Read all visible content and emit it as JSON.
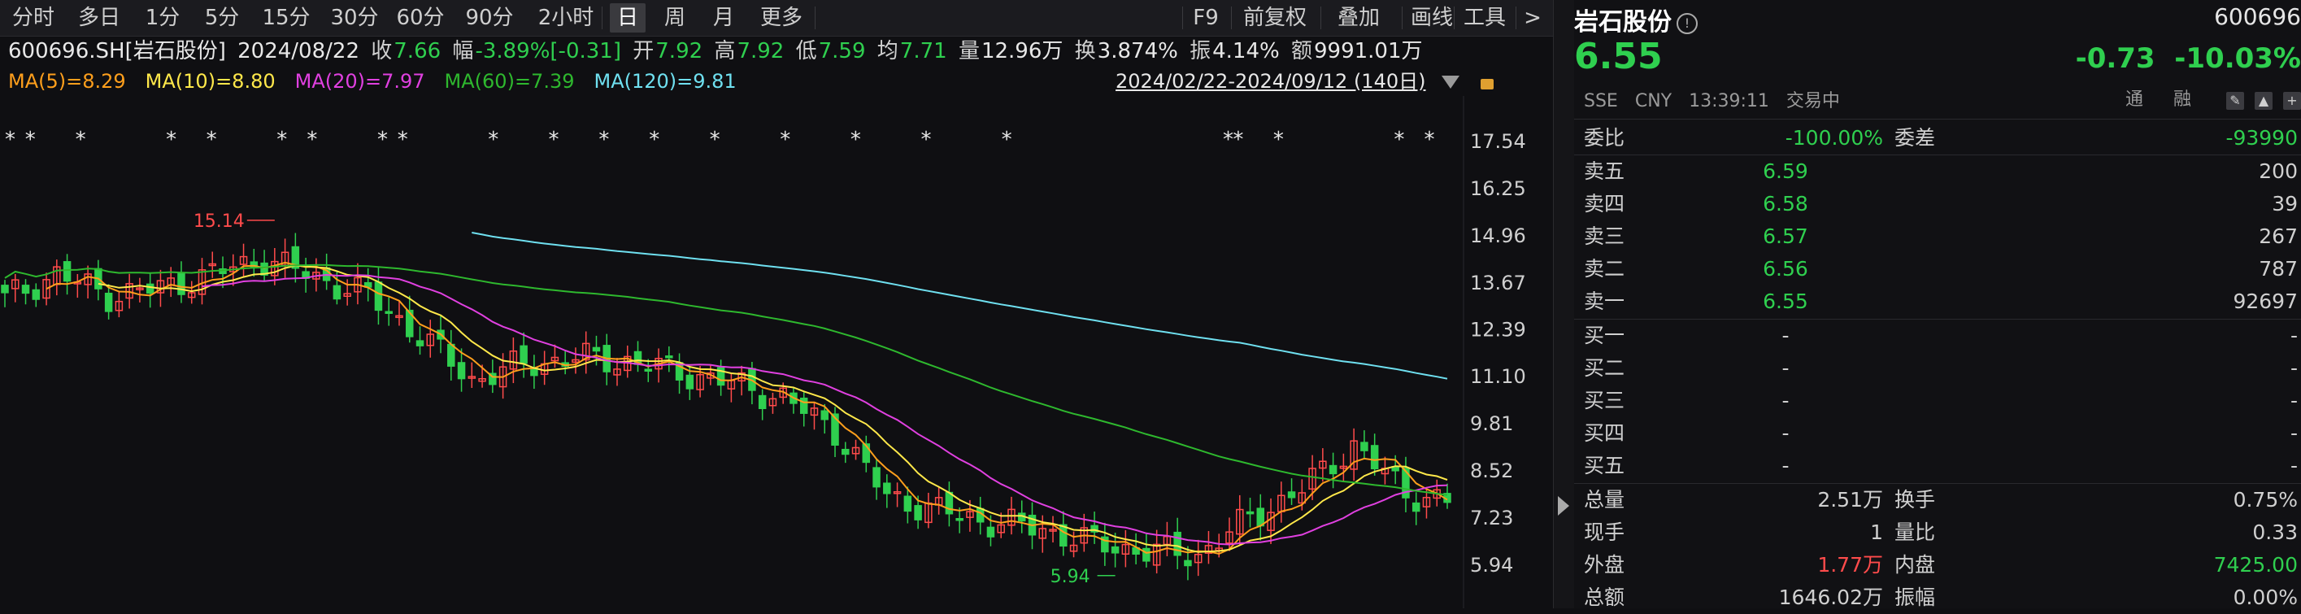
{
  "toolbar": {
    "periods": [
      "分时",
      "多日",
      "1分",
      "5分",
      "15分",
      "30分",
      "60分",
      "90分",
      "2小时",
      "日",
      "周",
      "月",
      "更多"
    ],
    "active_period": "日",
    "right_tools": [
      "F9",
      "前复权",
      "叠加",
      "画线",
      "工具",
      ">"
    ]
  },
  "quote": {
    "symbol": "600696.SH[岩石股份]",
    "date": "2024/08/22",
    "close_label": "收",
    "close": "7.66",
    "amp_label": "幅",
    "change_pct": "-3.89%[-0.31]",
    "open_label": "开",
    "open": "7.92",
    "high_label": "高",
    "high": "7.92",
    "low_label": "低",
    "low": "7.59",
    "avg_label": "均",
    "avg": "7.71",
    "vol_label": "量",
    "volume": "12.96万",
    "turn_label": "换",
    "turnover": "3.874%",
    "swing_label": "振",
    "swing": "4.14%",
    "amount_label": "额",
    "amount": "9991.01万"
  },
  "ma": [
    {
      "label": "MA(5)=8.29",
      "color": "#ff9f1c"
    },
    {
      "label": "MA(10)=8.80",
      "color": "#ffe84a"
    },
    {
      "label": "MA(20)=7.97",
      "color": "#e040e0"
    },
    {
      "label": "MA(60)=7.39",
      "color": "#2eb82e"
    },
    {
      "label": "MA(120)=9.81",
      "color": "#6fe0f0"
    }
  ],
  "range": {
    "label": "2024/02/22-2024/09/12 (140日)"
  },
  "chart_data": {
    "type": "candlestick",
    "y_ticks": [
      17.54,
      16.25,
      14.96,
      13.67,
      12.39,
      11.1,
      9.81,
      8.52,
      7.23,
      5.94
    ],
    "ylim": [
      5.4,
      18.1
    ],
    "annotations": [
      {
        "label": "15.14",
        "value": 15.14,
        "index": 26
      },
      {
        "label": "5.94",
        "value": 5.94,
        "index": 107
      }
    ],
    "ma120_start_index": 45,
    "candles_count": 140
  },
  "stock": {
    "name": "岩石股份",
    "code": "600696",
    "price": "6.55",
    "change": "-0.73",
    "change_pct": "-10.03%",
    "exchange": "SSE",
    "currency": "CNY",
    "time": "13:39:11",
    "status": "交易中",
    "tag1": "通",
    "tag2": "融"
  },
  "order_ratio": {
    "label1": "委比",
    "value1": "-100.00%",
    "label2": "委差",
    "value2": "-93990"
  },
  "asks": [
    {
      "label": "卖五",
      "price": "6.59",
      "vol": "200"
    },
    {
      "label": "卖四",
      "price": "6.58",
      "vol": "39"
    },
    {
      "label": "卖三",
      "price": "6.57",
      "vol": "267"
    },
    {
      "label": "卖二",
      "price": "6.56",
      "vol": "787"
    },
    {
      "label": "卖一",
      "price": "6.55",
      "vol": "92697"
    }
  ],
  "bids": [
    {
      "label": "买一",
      "price": "-",
      "vol": "-"
    },
    {
      "label": "买二",
      "price": "-",
      "vol": "-"
    },
    {
      "label": "买三",
      "price": "-",
      "vol": "-"
    },
    {
      "label": "买四",
      "price": "-",
      "vol": "-"
    },
    {
      "label": "买五",
      "price": "-",
      "vol": "-"
    }
  ],
  "stats": [
    {
      "l1": "总量",
      "v1": "2.51万",
      "l2": "换手",
      "v2": "0.75%"
    },
    {
      "l1": "现手",
      "v1": "1",
      "l2": "量比",
      "v2": "0.33"
    },
    {
      "l1": "外盘",
      "v1": "1.77万",
      "l2": "内盘",
      "v2": "7425.00"
    },
    {
      "l1": "总额",
      "v1": "1646.02万",
      "l2": "振幅",
      "v2": "0.00%"
    }
  ],
  "colors": {
    "up": "#ff4b4b",
    "down": "#2fcf4f",
    "text": "#d0d0d0"
  }
}
